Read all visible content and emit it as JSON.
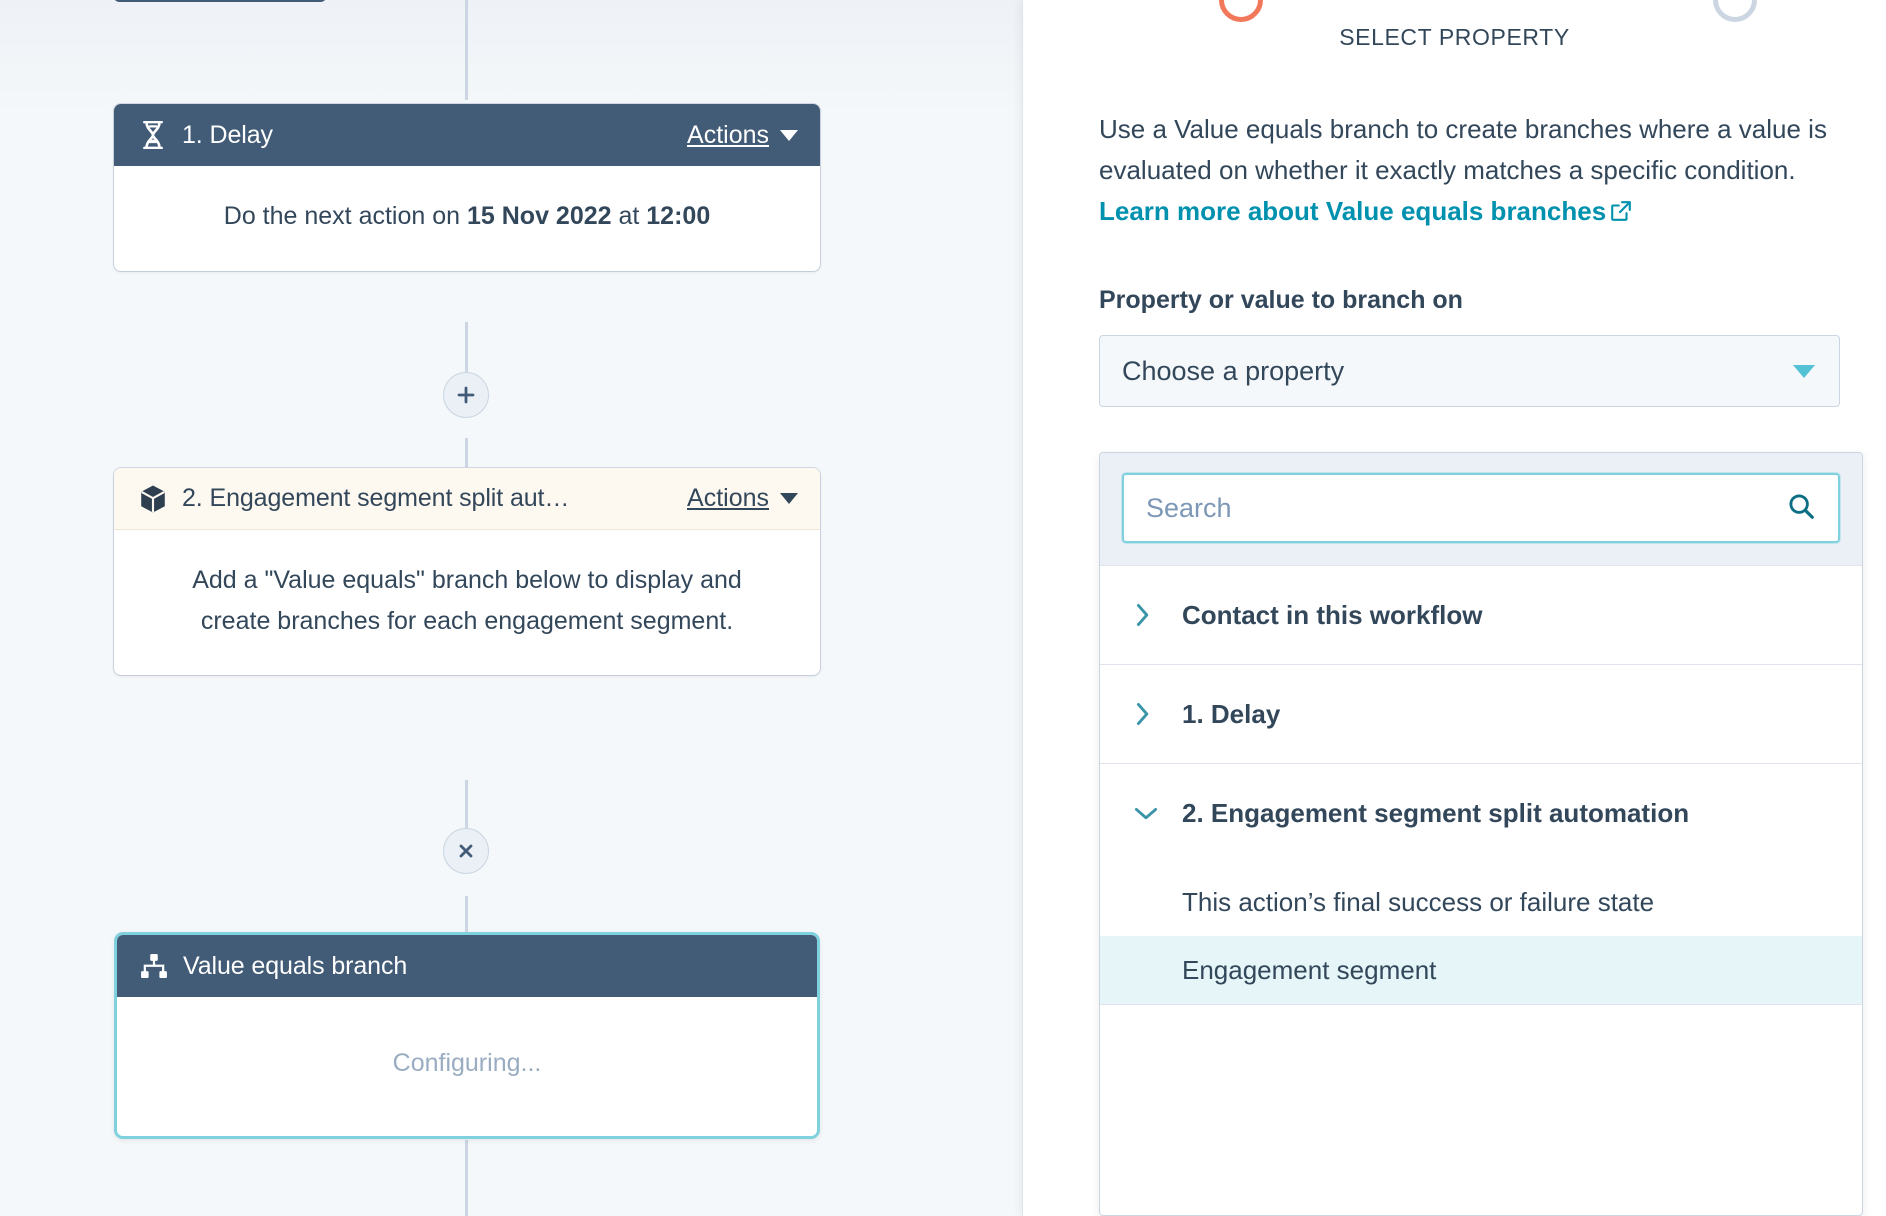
{
  "canvas": {
    "nodes": [
      {
        "icon": "hourglass-icon",
        "title": "1. Delay",
        "actions_label": "Actions",
        "body_prefix": "Do the next action on ",
        "body_date": "15 Nov 2022",
        "body_middle": " at ",
        "body_time": "12:00"
      },
      {
        "icon": "cube-icon",
        "title": "2. Engagement segment split aut…",
        "actions_label": "Actions",
        "body": "Add a \"Value equals\" branch below to display and create branches for each engagement segment."
      },
      {
        "icon": "branch-icon",
        "title": "Value equals branch",
        "body": "Configuring..."
      }
    ],
    "connectors": [
      {
        "icon": "plus-icon"
      },
      {
        "icon": "close-icon"
      }
    ]
  },
  "panel": {
    "step_title": "SELECT PROPERTY",
    "description_part1": "Use a Value equals branch to create branches where a value is evaluated on whether it exactly matches a specific condition. ",
    "description_link": "Learn more about Value equals branches",
    "field_label": "Property or value to branch on",
    "select_value": "Choose a property",
    "search_placeholder": "Search",
    "dropdown_groups": [
      {
        "label": "Contact in this workflow",
        "expanded": false,
        "options": []
      },
      {
        "label": "1. Delay",
        "expanded": false,
        "options": []
      },
      {
        "label": "2. Engagement segment split automation",
        "expanded": true,
        "options": [
          {
            "label": "This action’s final success or failure state",
            "selected": false
          },
          {
            "label": "Engagement segment",
            "selected": true
          }
        ]
      }
    ]
  },
  "colors": {
    "header_dark": "#425b76",
    "header_cream": "#fdf8f0",
    "accent_teal": "#00bda5",
    "link_teal": "#0091ae",
    "border_focus": "#7fd1de",
    "step_active": "#f2785c",
    "step_idle": "#cbd6e2",
    "selected_row": "#e5f5f8",
    "canvas_bg": "#f5f8fa"
  }
}
